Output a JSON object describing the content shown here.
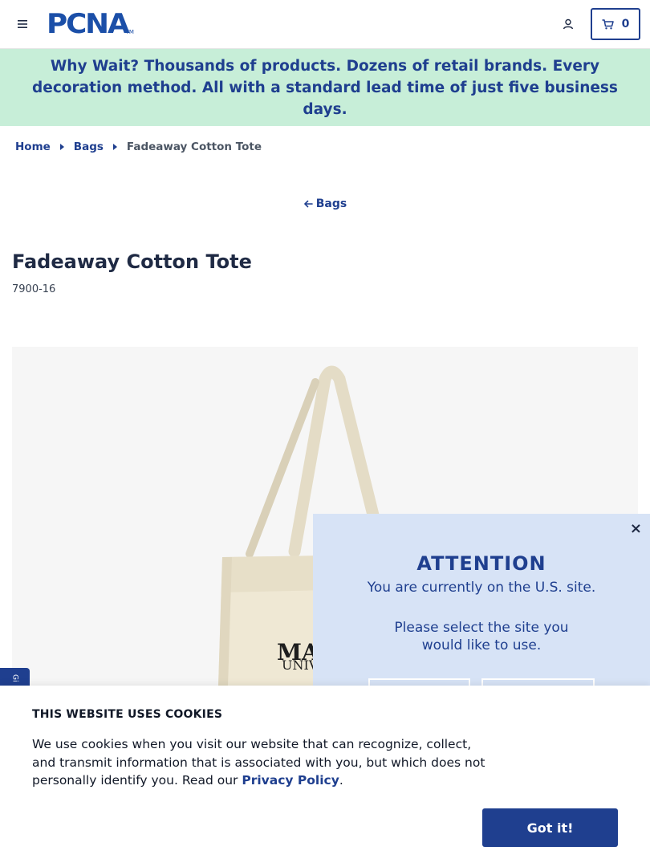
{
  "header": {
    "logo_text": "PCNA",
    "logo_tm": "TM",
    "cart_count": "0"
  },
  "promo": {
    "lead": "Why Wait?",
    "text": "Thousands of products. Dozens of retail brands. Every decoration method. All with a standard lead time of just five business days."
  },
  "breadcrumb": {
    "items": [
      "Home",
      "Bags"
    ],
    "current": "Fadeaway Cotton Tote"
  },
  "back_link": "Bags",
  "product": {
    "title": "Fadeaway Cotton Tote",
    "sku": "7900-16",
    "imprint_line1": "MA",
    "imprint_line2": "UNIV"
  },
  "side_tab": "Gi",
  "site_popup": {
    "close": "×",
    "title": "ATTENTION",
    "line1": "You are currently on the U.S. site.",
    "line2": "Please select the site you would like to use."
  },
  "cookie": {
    "title": "THIS WEBSITE USES COOKIES",
    "text": "We use cookies when you visit our website that can recognize, collect, and transmit information that is associated with you, but which does not personally identify you. Read our ",
    "link": "Privacy Policy",
    "period": ".",
    "button": "Got it!"
  },
  "colors": {
    "brand": "#1f3f8f",
    "promo_bg": "#c7eed8",
    "popup_bg": "#d7e3f6"
  }
}
